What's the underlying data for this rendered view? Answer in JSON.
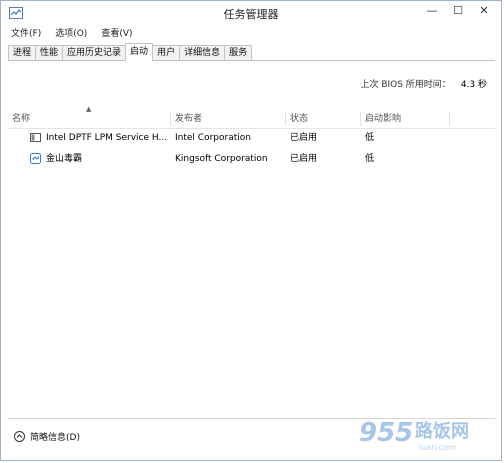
{
  "window": {
    "title": "任务管理器",
    "controls": {
      "minimize": "—",
      "maximize": "☐",
      "close": "✕"
    }
  },
  "menu": [
    "文件(F)",
    "选项(O)",
    "查看(V)"
  ],
  "tabs": [
    {
      "label": "进程",
      "active": false
    },
    {
      "label": "性能",
      "active": false
    },
    {
      "label": "应用历史记录",
      "active": false
    },
    {
      "label": "启动",
      "active": true
    },
    {
      "label": "用户",
      "active": false
    },
    {
      "label": "详细信息",
      "active": false
    },
    {
      "label": "服务",
      "active": false
    }
  ],
  "bios": {
    "label": "上次 BIOS 所用时间：",
    "value": "4.3 秒"
  },
  "table": {
    "columns": [
      "名称",
      "发布者",
      "状态",
      "启动影响"
    ],
    "rows": [
      {
        "icon": "service-app-icon",
        "name": "Intel DPTF LPM Service H...",
        "publisher": "Intel Corporation",
        "status": "已启用",
        "impact": "低"
      },
      {
        "icon": "kingsoft-icon",
        "name": "金山毒霸",
        "publisher": "Kingsoft Corporation",
        "status": "已启用",
        "impact": "低"
      }
    ]
  },
  "footer": {
    "fewer_details": "简略信息(D)"
  },
  "watermark": {
    "text": "955 路饭网",
    "sub": "luan.com"
  },
  "colors": {
    "accent": "#3a7fc2",
    "border": "#c3c3c3",
    "header_text": "#555555"
  }
}
